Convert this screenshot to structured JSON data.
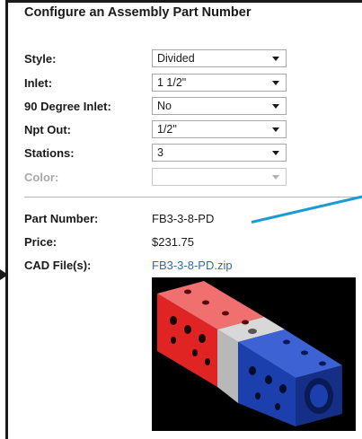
{
  "panel": {
    "title": "Configure an Assembly Part Number"
  },
  "form": {
    "style": {
      "label": "Style:",
      "value": "Divided"
    },
    "inlet": {
      "label": "Inlet:",
      "value": "1 1/2\""
    },
    "inlet90": {
      "label": "90 Degree Inlet:",
      "value": "No"
    },
    "npt": {
      "label": "Npt Out:",
      "value": "1/2\""
    },
    "stations": {
      "label": "Stations:",
      "value": "3"
    },
    "color": {
      "label": "Color:",
      "value": ""
    }
  },
  "result": {
    "part_number": {
      "label": "Part Number:",
      "value": "FB3-3-8-PD"
    },
    "price": {
      "label": "Price:",
      "value": "$231.75"
    },
    "cad": {
      "label": "CAD File(s):",
      "value": "FB3-3-8-PD.zip"
    }
  },
  "colors": {
    "link": "#2a6cb0",
    "annotation": "#1b9bd1",
    "red_block": "#e02424",
    "blue_block": "#1c3fae",
    "separator": "#c0c0c0"
  }
}
